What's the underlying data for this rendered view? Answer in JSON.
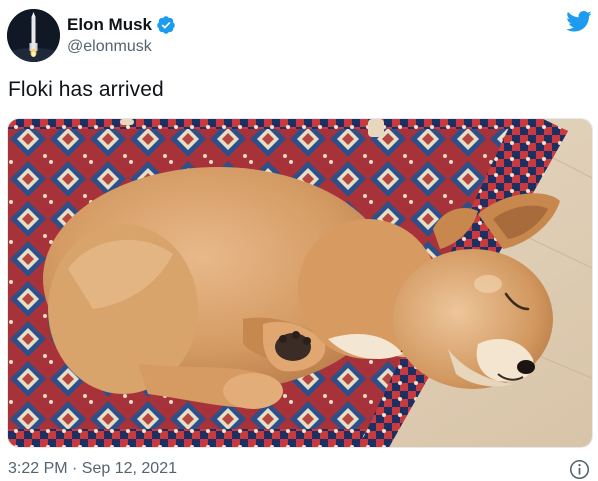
{
  "author": {
    "display_name": "Elon Musk",
    "handle": "@elonmusk",
    "verified": true,
    "avatar_icon": "rocket-avatar"
  },
  "tweet": {
    "text": "Floki has arrived",
    "media_description_icon": "shiba-puppy-photo",
    "timestamp": "3:22 PM · Sep 12, 2021"
  },
  "icons": {
    "brand": "twitter-bird-icon",
    "info": "info-icon",
    "verified": "verified-badge-icon"
  },
  "colors": {
    "brand": "#1d9bf0",
    "text_primary": "#0f1419",
    "text_secondary": "#536471"
  }
}
